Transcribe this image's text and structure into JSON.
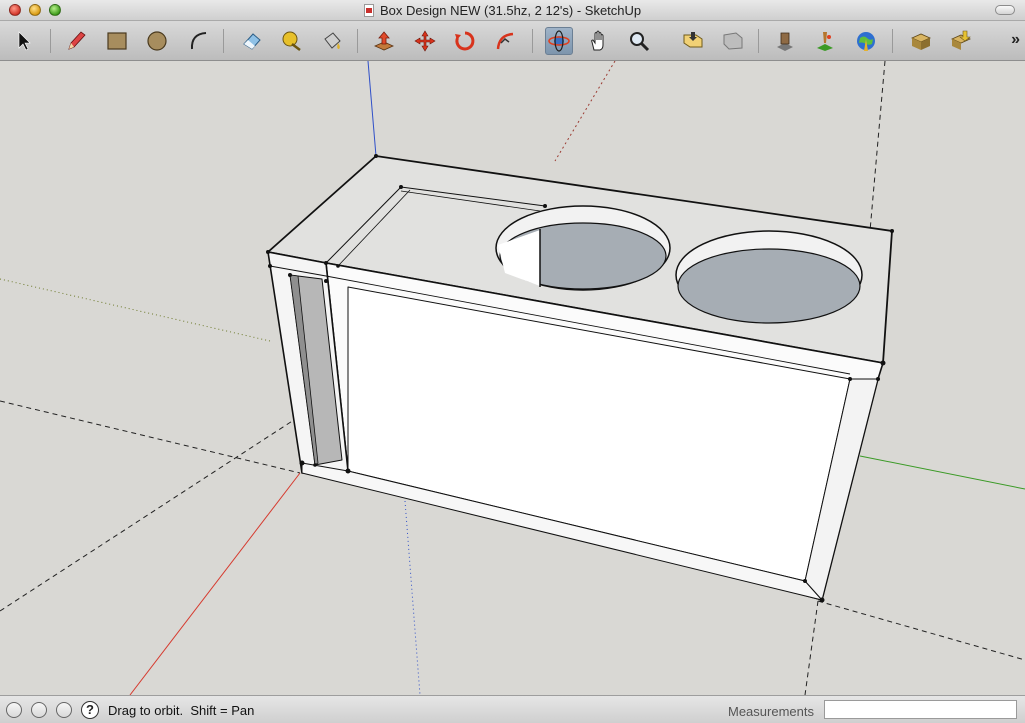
{
  "window": {
    "title": "Box Design NEW (31.5hz, 2 12's) - SketchUp"
  },
  "toolbar": {
    "tools": [
      {
        "name": "select-tool",
        "icon": "arrow-cursor-icon"
      },
      {
        "name": "pencil-tool",
        "icon": "pencil-icon"
      },
      {
        "name": "rectangle-tool",
        "icon": "rectangle-icon"
      },
      {
        "name": "circle-tool",
        "icon": "circle-icon"
      },
      {
        "name": "arc-tool",
        "icon": "arc-icon"
      },
      {
        "name": "eraser-tool",
        "icon": "eraser-icon"
      },
      {
        "name": "tape-measure-tool",
        "icon": "tape-measure-icon"
      },
      {
        "name": "paint-bucket-tool",
        "icon": "paint-bucket-icon"
      },
      {
        "name": "push-pull-tool",
        "icon": "push-pull-icon"
      },
      {
        "name": "move-tool",
        "icon": "move-icon"
      },
      {
        "name": "rotate-tool",
        "icon": "rotate-icon"
      },
      {
        "name": "follow-me-tool",
        "icon": "follow-me-icon"
      },
      {
        "name": "orbit-tool",
        "icon": "orbit-icon",
        "active": true
      },
      {
        "name": "pan-tool",
        "icon": "hand-icon"
      },
      {
        "name": "zoom-tool",
        "icon": "magnifier-icon"
      },
      {
        "name": "zoom-extents-tool",
        "icon": "zoom-extents-icon"
      },
      {
        "name": "previous-view-tool",
        "icon": "previous-view-icon"
      },
      {
        "name": "get-models-tool",
        "icon": "get-models-icon"
      },
      {
        "name": "place-model-tool",
        "icon": "place-model-icon"
      },
      {
        "name": "google-earth-tool",
        "icon": "google-earth-icon"
      },
      {
        "name": "share-component-tool",
        "icon": "share-component-icon"
      },
      {
        "name": "get-components-tool",
        "icon": "get-components-icon"
      }
    ],
    "overflow_label": "»"
  },
  "status": {
    "hint": "Drag to orbit.  Shift = Pan",
    "help_symbol": "?",
    "measurements_label": "Measurements",
    "measurements_value": ""
  },
  "colors": {
    "background": "#d9d8d4",
    "axis_red": "#d63a2e",
    "axis_green": "#3a9a25",
    "axis_blue": "#3050c8",
    "face_light": "#ffffff",
    "face_grey": "#e1e1df",
    "hole_inner": "#a6adb4"
  }
}
